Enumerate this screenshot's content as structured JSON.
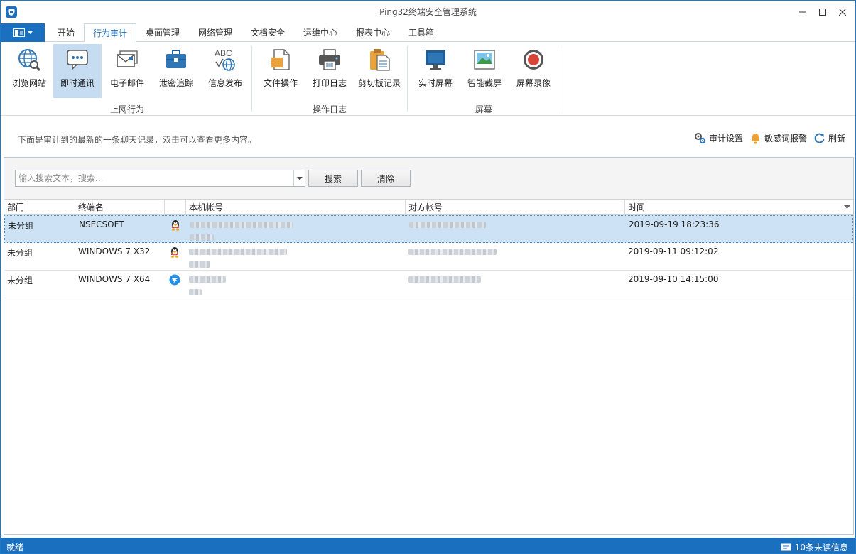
{
  "window": {
    "title": "Ping32终端安全管理系统"
  },
  "tabs": [
    {
      "label": "开始"
    },
    {
      "label": "行为审计"
    },
    {
      "label": "桌面管理"
    },
    {
      "label": "网络管理"
    },
    {
      "label": "文档安全"
    },
    {
      "label": "运维中心"
    },
    {
      "label": "报表中心"
    },
    {
      "label": "工具箱"
    }
  ],
  "active_tab": "行为审计",
  "ribbon": {
    "groups": [
      {
        "label": "上网行为"
      },
      {
        "label": "操作日志"
      },
      {
        "label": "屏幕"
      }
    ],
    "buttons": [
      {
        "label": "浏览网站",
        "icon": "globe-search-icon"
      },
      {
        "label": "即时通讯",
        "icon": "chat-bubble-icon"
      },
      {
        "label": "电子邮件",
        "icon": "email-icon"
      },
      {
        "label": "泄密追踪",
        "icon": "briefcase-icon"
      },
      {
        "label": "信息发布",
        "icon": "abc-globe-icon"
      },
      {
        "label": "文件操作",
        "icon": "file-icon"
      },
      {
        "label": "打印日志",
        "icon": "printer-icon"
      },
      {
        "label": "剪切板记录",
        "icon": "clipboard-icon"
      },
      {
        "label": "实时屏幕",
        "icon": "monitor-icon"
      },
      {
        "label": "智能截屏",
        "icon": "image-icon"
      },
      {
        "label": "屏幕录像",
        "icon": "record-icon"
      }
    ],
    "active_button": "即时通讯"
  },
  "info": {
    "text": "下面是审计到的最新的一条聊天记录，双击可以查看更多内容。",
    "actions": [
      {
        "label": "审计设置",
        "icon": "gears-icon"
      },
      {
        "label": "敏感词报警",
        "icon": "bell-icon"
      },
      {
        "label": "刷新",
        "icon": "refresh-icon"
      }
    ]
  },
  "search": {
    "placeholder": "输入搜索文本，搜索...",
    "search_label": "搜索",
    "clear_label": "清除"
  },
  "table": {
    "columns": [
      {
        "label": "部门"
      },
      {
        "label": "终端名"
      },
      {
        "label": ""
      },
      {
        "label": "本机帐号"
      },
      {
        "label": "对方帐号"
      },
      {
        "label": "时间"
      }
    ],
    "rows": [
      {
        "dept": "未分组",
        "terminal": "NSECSOFT",
        "app_icon": "qq-penguin-icon",
        "time": "2019-09-19 18:23:36",
        "selected": true
      },
      {
        "dept": "未分组",
        "terminal": "WINDOWS 7 X32",
        "app_icon": "qq-penguin-icon",
        "time": "2019-09-11 09:12:02",
        "selected": false
      },
      {
        "dept": "未分组",
        "terminal": "WINDOWS 7 X64",
        "app_icon": "dingtalk-icon",
        "time": "2019-09-10 14:15:00",
        "selected": false
      }
    ]
  },
  "status": {
    "left": "就绪",
    "right": "10条未读信息"
  },
  "colors": {
    "accent": "#1b6fbf",
    "selected_row": "#cde3f5",
    "active_button": "#c5dcf1"
  }
}
